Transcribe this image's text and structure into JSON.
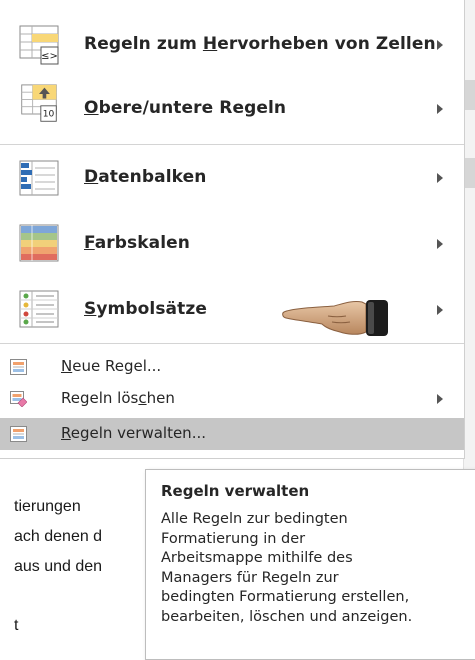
{
  "menu": {
    "big_items": [
      {
        "label_pre": "Regeln zum ",
        "label_accel": "H",
        "label_post": "ervorheben von Zellen",
        "icon": "highlight-cells-rules-icon",
        "has_submenu": true
      },
      {
        "label_pre": "",
        "label_accel": "O",
        "label_post": "bere/untere Regeln",
        "icon": "top-bottom-rules-icon",
        "has_submenu": true
      },
      {
        "label_pre": "",
        "label_accel": "D",
        "label_post": "atenbalken",
        "icon": "data-bars-icon",
        "has_submenu": true
      },
      {
        "label_pre": "",
        "label_accel": "F",
        "label_post": "arbskalen",
        "icon": "color-scales-icon",
        "has_submenu": true
      },
      {
        "label_pre": "",
        "label_accel": "S",
        "label_post": "ymbolsätze",
        "icon": "icon-sets-icon",
        "has_submenu": true
      }
    ],
    "small_items": [
      {
        "label_pre": "",
        "label_accel": "N",
        "label_post": "eue Regel...",
        "icon": "new-rule-icon",
        "has_submenu": false
      },
      {
        "label_pre": "Regeln lös",
        "label_accel": "c",
        "label_post": "hen",
        "icon": "clear-rules-icon",
        "has_submenu": true
      },
      {
        "label_pre": "",
        "label_accel": "R",
        "label_post": "egeln verwalten...",
        "icon": "manage-rules-icon",
        "has_submenu": false
      }
    ],
    "icon_texts": {
      "highlight": "≤>",
      "topbottom": "10"
    }
  },
  "document": {
    "lines": [
      "tierungen",
      "ach denen d",
      "aus und den",
      "t"
    ]
  },
  "tooltip": {
    "title": "Regeln verwalten",
    "lines": [
      "Alle Regeln zur bedingten",
      "Formatierung in der",
      "Arbeitsmappe mithilfe des",
      "Managers für Regeln zur",
      "bedingten Formatierung erstellen,",
      "bearbeiten, löschen und anzeigen."
    ]
  },
  "colors": {
    "selected_bg": "#c6c6c6",
    "data_bar_blue": "#2f6db5",
    "highlight_yellow": "#f8d777"
  }
}
